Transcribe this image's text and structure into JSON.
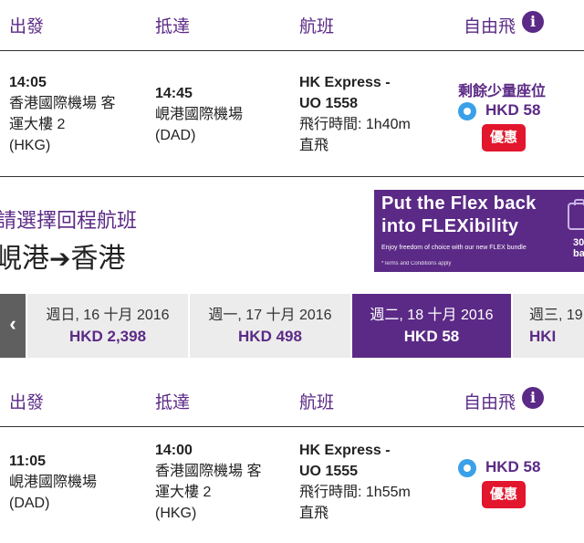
{
  "outbound": {
    "header": {
      "depart": "出發",
      "arrive": "抵達",
      "flight": "航班",
      "fare": "自由飛"
    },
    "flight": {
      "dep_time": "14:05",
      "dep_airport_l1": "香港國際機場 客",
      "dep_airport_l2": "運大樓 2",
      "dep_code": "(HKG)",
      "arr_time": "14:45",
      "arr_airport": "峴港國際機場",
      "arr_code": "(DAD)",
      "carrier": "HK Express -",
      "flight_no": "UO 1558",
      "duration": "飛行時間: 1h40m",
      "type": "直飛",
      "seats_note": "剩餘少量座位",
      "price": "HKD 58",
      "promo": "優惠"
    }
  },
  "return": {
    "title": "請選擇回程航班",
    "route_from": "峴港",
    "route_arrow": "➔",
    "route_to": "香港"
  },
  "banner": {
    "line1": "Put the Flex back",
    "line2": "into FLEXibility",
    "line3": "Enjoy freedom of choice with our new FLEX bundle",
    "line4": "*Terms and Conditions apply",
    "side1": "30",
    "side2": "bag"
  },
  "date_tabs": {
    "prev_icon": "‹",
    "items": [
      {
        "date": "週日, 16 十月 2016",
        "price": "HKD 2,398"
      },
      {
        "date": "週一, 17 十月 2016",
        "price": "HKD 498"
      },
      {
        "date": "週二, 18 十月 2016",
        "price": "HKD 58"
      },
      {
        "date": "週三, 19",
        "price": "HKI"
      }
    ]
  },
  "inbound": {
    "header": {
      "depart": "出發",
      "arrive": "抵達",
      "flight": "航班",
      "fare": "自由飛"
    },
    "flight": {
      "dep_time": "11:05",
      "dep_airport": "峴港國際機場",
      "dep_code": "(DAD)",
      "arr_time": "14:00",
      "arr_airport_l1": "香港國際機場 客",
      "arr_airport_l2": "運大樓 2",
      "arr_code": "(HKG)",
      "carrier": "HK Express -",
      "flight_no": "UO 1555",
      "duration": "飛行時間: 1h55m",
      "type": "直飛",
      "price": "HKD 58",
      "promo": "優惠"
    }
  },
  "colors": {
    "brand": "#5b2a86",
    "promo": "#e2162c",
    "radio": "#3aa0e8"
  }
}
